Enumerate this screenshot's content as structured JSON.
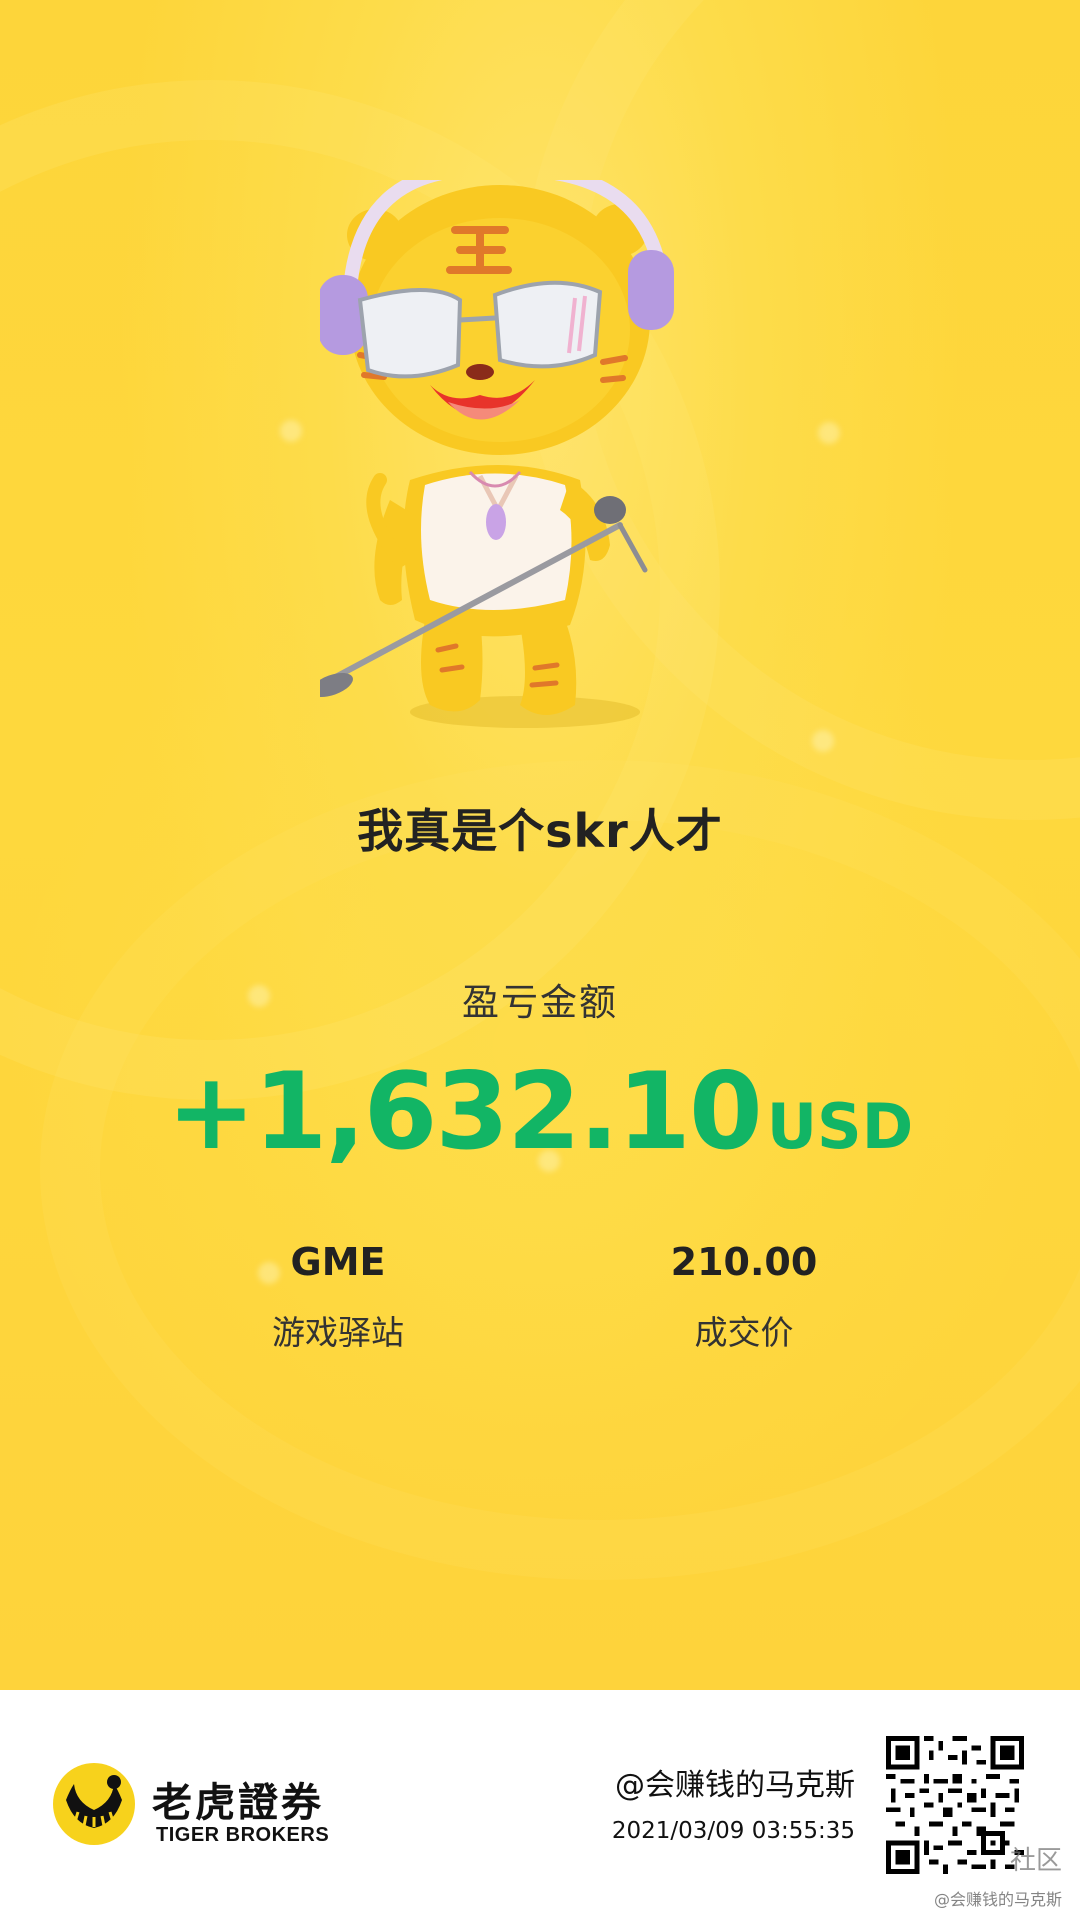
{
  "share_card": {
    "tagline": "我真是个skr人才",
    "pnl_label": "盈亏金额",
    "pnl_amount": "+1,632.10",
    "pnl_currency": "USD",
    "ticker": "GME",
    "company_name": "游戏驿站",
    "trade_price": "210.00",
    "trade_price_label": "成交价"
  },
  "footer": {
    "brand_cn": "老虎證券",
    "brand_en": "TIGER BROKERS",
    "shared_by": "@会赚钱的马克斯",
    "timestamp": "2021/03/09 03:55:35"
  },
  "watermark": {
    "community": "社区",
    "author": "@会赚钱的马克斯"
  },
  "colors": {
    "background_yellow": "#fdd53a",
    "profit_green": "#12b565",
    "footer_bg": "#ffffff",
    "text_dark": "#222222"
  },
  "icons": {
    "mascot": "tiger-mascot-headphones-microphone",
    "brand_logo": "tiger-brokers-logo-icon",
    "qr_code": "qr-code-icon"
  }
}
